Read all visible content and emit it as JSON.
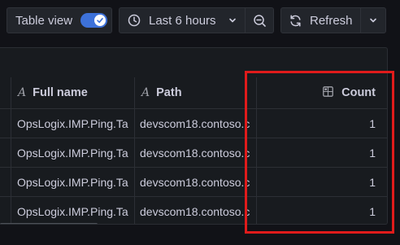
{
  "toolbar": {
    "table_view_label": "Table view",
    "table_view_on": true,
    "time_range_label": "Last 6 hours",
    "refresh_label": "Refresh"
  },
  "table": {
    "columns": [
      {
        "label": "Full name",
        "type_icon": "A"
      },
      {
        "label": "Path",
        "type_icon": "A"
      },
      {
        "label": "Count",
        "type_icon": "grid-icon"
      }
    ],
    "rows": [
      {
        "full_name": "OpsLogix.IMP.Ping.Ta",
        "path": "devscom18.contoso.c",
        "count": "1"
      },
      {
        "full_name": "OpsLogix.IMP.Ping.Ta",
        "path": "devscom18.contoso.c",
        "count": "1"
      },
      {
        "full_name": "OpsLogix.IMP.Ping.Ta",
        "path": "devscom18.contoso.c",
        "count": "1"
      },
      {
        "full_name": "OpsLogix.IMP.Ping.Ta",
        "path": "devscom18.contoso.c",
        "count": "1"
      }
    ]
  },
  "colors": {
    "accent": "#3d71d9",
    "highlight": "#e01b1b",
    "background": "#111217",
    "panel": "#181b1f"
  }
}
